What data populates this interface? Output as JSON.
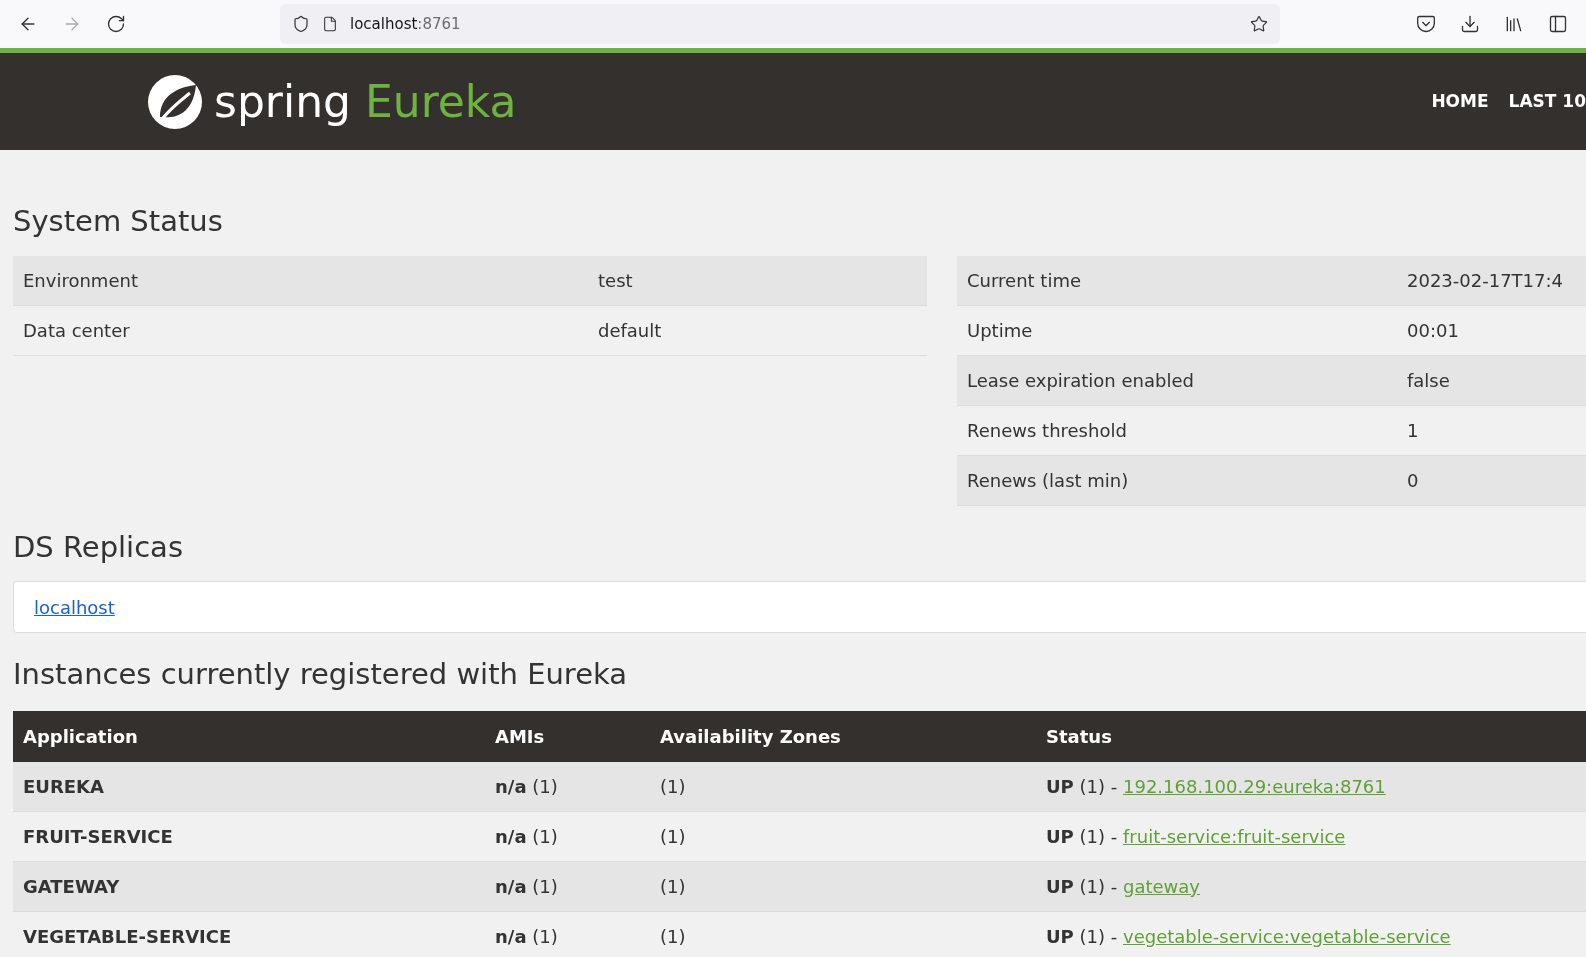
{
  "browser": {
    "address_host": "localhost",
    "address_port": ":8761"
  },
  "header": {
    "brand": "spring",
    "product": "Eureka",
    "nav": [
      "HOME",
      "LAST 10"
    ]
  },
  "system_status": {
    "title": "System Status",
    "left": [
      {
        "label": "Environment",
        "value": "test"
      },
      {
        "label": "Data center",
        "value": "default"
      }
    ],
    "right": [
      {
        "label": "Current time",
        "value": "2023-02-17T17:4"
      },
      {
        "label": "Uptime",
        "value": "00:01"
      },
      {
        "label": "Lease expiration enabled",
        "value": "false"
      },
      {
        "label": "Renews threshold",
        "value": "1"
      },
      {
        "label": "Renews (last min)",
        "value": "0"
      }
    ]
  },
  "ds_replicas": {
    "title": "DS Replicas",
    "links": [
      "localhost"
    ]
  },
  "instances": {
    "title": "Instances currently registered with Eureka",
    "columns": [
      "Application",
      "AMIs",
      "Availability Zones",
      "Status"
    ],
    "rows": [
      {
        "application": "EUREKA",
        "amis": "**n/a** (1)",
        "zones": "(1)",
        "status": "**UP** (1) - ",
        "link": "192.168.100.29:eureka:8761"
      },
      {
        "application": "FRUIT-SERVICE",
        "amis": "**n/a** (1)",
        "zones": "(1)",
        "status": "**UP** (1) - ",
        "link": "fruit-service:fruit-service"
      },
      {
        "application": "GATEWAY",
        "amis": "**n/a** (1)",
        "zones": "(1)",
        "status": "**UP** (1) - ",
        "link": "gateway"
      },
      {
        "application": "VEGETABLE-SERVICE",
        "amis": "**n/a** (1)",
        "zones": "(1)",
        "status": "**UP** (1) - ",
        "link": "vegetable-service:vegetable-service"
      }
    ]
  }
}
